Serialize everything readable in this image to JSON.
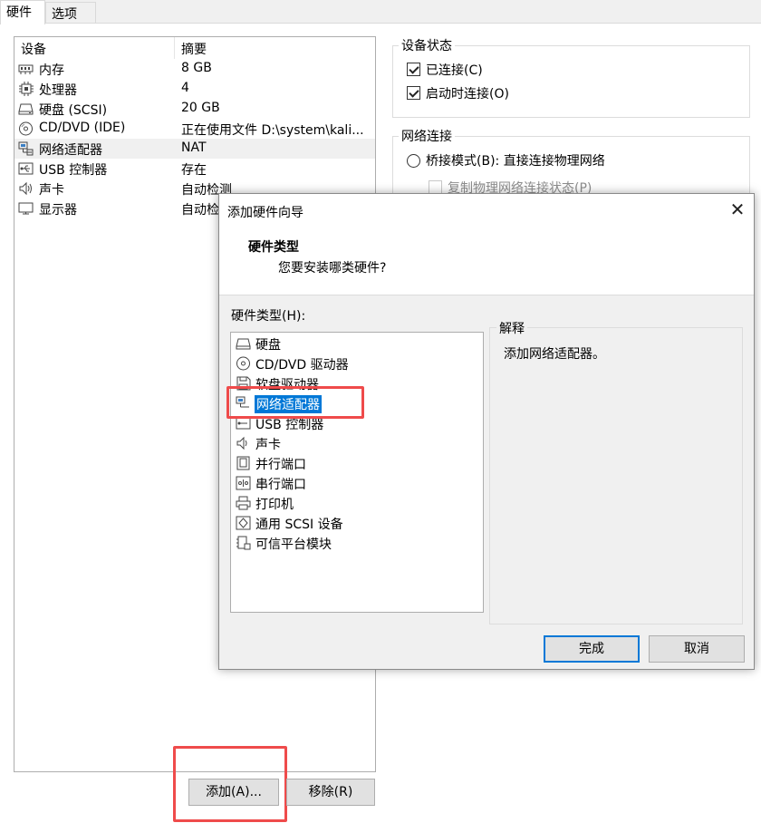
{
  "tabs": [
    "硬件",
    "选项"
  ],
  "device_list": {
    "col_device": "设备",
    "col_summary": "摘要",
    "rows": [
      {
        "icon": "memory-icon",
        "name": "内存",
        "summary": "8 GB"
      },
      {
        "icon": "cpu-icon",
        "name": "处理器",
        "summary": "4"
      },
      {
        "icon": "harddisk-icon",
        "name": "硬盘 (SCSI)",
        "summary": "20 GB"
      },
      {
        "icon": "cdrom-icon",
        "name": "CD/DVD (IDE)",
        "summary": "正在使用文件 D:\\system\\kali..."
      },
      {
        "icon": "network-adapter-icon",
        "name": "网络适配器",
        "summary": "NAT"
      },
      {
        "icon": "usb-icon",
        "name": "USB 控制器",
        "summary": "存在"
      },
      {
        "icon": "sound-icon",
        "name": "声卡",
        "summary": "自动检测"
      },
      {
        "icon": "display-icon",
        "name": "显示器",
        "summary": "自动检"
      }
    ]
  },
  "device_status": {
    "title": "设备状态",
    "connected": "已连接(C)",
    "connect_on_power": "启动时连接(O)"
  },
  "network_connection": {
    "title": "网络连接",
    "bridged": "桥接模式(B): 直接连接物理网络",
    "replicate": "复制物理网络连接状态(P)"
  },
  "buttons": {
    "add": "添加(A)...",
    "remove": "移除(R)"
  },
  "dialog": {
    "title": "添加硬件向导",
    "heading": "硬件类型",
    "subheading": "您要安装哪类硬件?",
    "list_label": "硬件类型(H):",
    "explain_title": "解释",
    "explain_text": "添加网络适配器。",
    "items": [
      {
        "icon": "harddisk-icon",
        "label": "硬盘"
      },
      {
        "icon": "cdrom-icon",
        "label": "CD/DVD 驱动器"
      },
      {
        "icon": "floppy-icon",
        "label": "软盘驱动器"
      },
      {
        "icon": "network-adapter-icon",
        "label": "网络适配器"
      },
      {
        "icon": "usb-icon",
        "label": "USB 控制器"
      },
      {
        "icon": "sound-icon",
        "label": "声卡"
      },
      {
        "icon": "parallel-port-icon",
        "label": "并行端口"
      },
      {
        "icon": "serial-port-icon",
        "label": "串行端口"
      },
      {
        "icon": "printer-icon",
        "label": "打印机"
      },
      {
        "icon": "scsi-device-icon",
        "label": "通用 SCSI 设备"
      },
      {
        "icon": "tpm-icon",
        "label": "可信平台模块"
      }
    ],
    "finish": "完成",
    "cancel": "取消"
  }
}
